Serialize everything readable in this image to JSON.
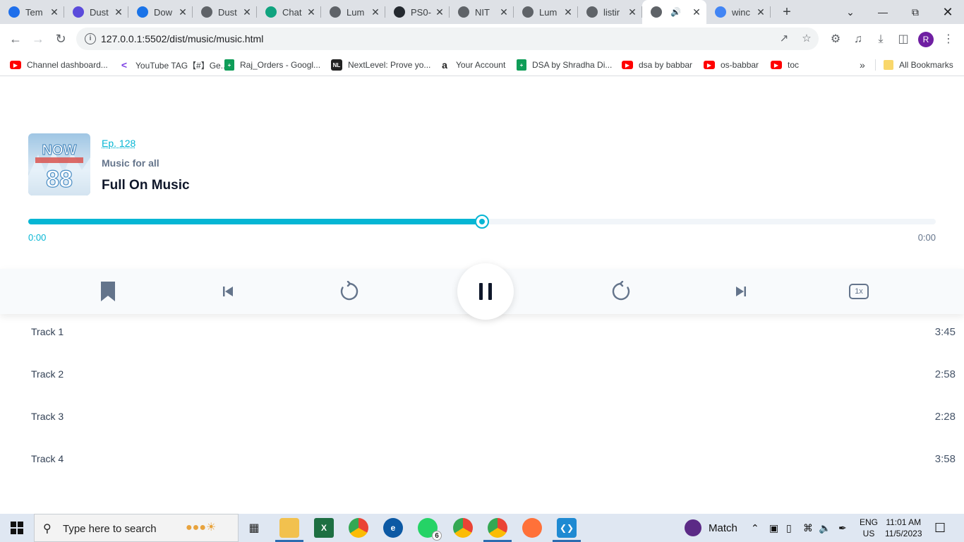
{
  "browser": {
    "tabs": [
      {
        "title": "Tem",
        "icon": "c-logo-icon",
        "color": "#1f6feb"
      },
      {
        "title": "Dust",
        "icon": "chat-bot-icon",
        "color": "#5b4bdb"
      },
      {
        "title": "Dow",
        "icon": "download-icon",
        "color": "#1a73e8"
      },
      {
        "title": "Dust",
        "icon": "globe-icon",
        "color": "#5f6368"
      },
      {
        "title": "Chat",
        "icon": "openai-icon",
        "color": "#10a37f"
      },
      {
        "title": "Lum",
        "icon": "globe-icon",
        "color": "#5f6368"
      },
      {
        "title": "PS0-",
        "icon": "github-icon",
        "color": "#24292f"
      },
      {
        "title": "NIT",
        "icon": "globe-icon",
        "color": "#5f6368"
      },
      {
        "title": "Lum",
        "icon": "globe-icon",
        "color": "#5f6368"
      },
      {
        "title": "listir",
        "icon": "globe-icon",
        "color": "#5f6368"
      },
      {
        "title": "",
        "icon": "globe-icon",
        "color": "#5f6368",
        "active": true,
        "audio": true
      },
      {
        "title": "winc",
        "icon": "google-icon",
        "color": "#4285f4"
      }
    ],
    "url": "127.0.0.1:5502/dist/music/music.html",
    "profile_initial": "R",
    "bookmarks": [
      {
        "label": "Channel dashboard...",
        "icon": "youtube-icon"
      },
      {
        "label": "YouTube TAG【#】Ge...",
        "icon": "tag-icon"
      },
      {
        "label": "Raj_Orders - Googl...",
        "icon": "sheets-icon"
      },
      {
        "label": "NextLevel: Prove yo...",
        "icon": "nl-icon"
      },
      {
        "label": "Your Account",
        "icon": "amazon-icon"
      },
      {
        "label": "DSA by Shradha Di...",
        "icon": "sheets-icon"
      },
      {
        "label": "dsa by babbar",
        "icon": "youtube-icon"
      },
      {
        "label": "os-babbar",
        "icon": "youtube-icon"
      },
      {
        "label": "toc",
        "icon": "youtube-icon"
      }
    ],
    "more_bookmarks": "»",
    "all_bookmarks": "All Bookmarks"
  },
  "player": {
    "episode": "Ep. 128",
    "subtitle": "Music for all",
    "title": "Full On Music",
    "cover_text": "NOW",
    "cover_number": "88",
    "progress_fraction": 0.5,
    "current_time": "0:00",
    "total_time": "0:00",
    "speed_label": "1x",
    "accent_color": "#06b6d4"
  },
  "tracks": [
    {
      "name": "Track 1",
      "duration": "3:45"
    },
    {
      "name": "Track 2",
      "duration": "2:58"
    },
    {
      "name": "Track 3",
      "duration": "2:28"
    },
    {
      "name": "Track 4",
      "duration": "3:58"
    }
  ],
  "taskbar": {
    "search_placeholder": "Type here to search",
    "weather_label": "Match",
    "whatsapp_badge": "6",
    "lang_top": "ENG",
    "lang_bottom": "US",
    "time": "11:01 AM",
    "date": "11/5/2023"
  }
}
